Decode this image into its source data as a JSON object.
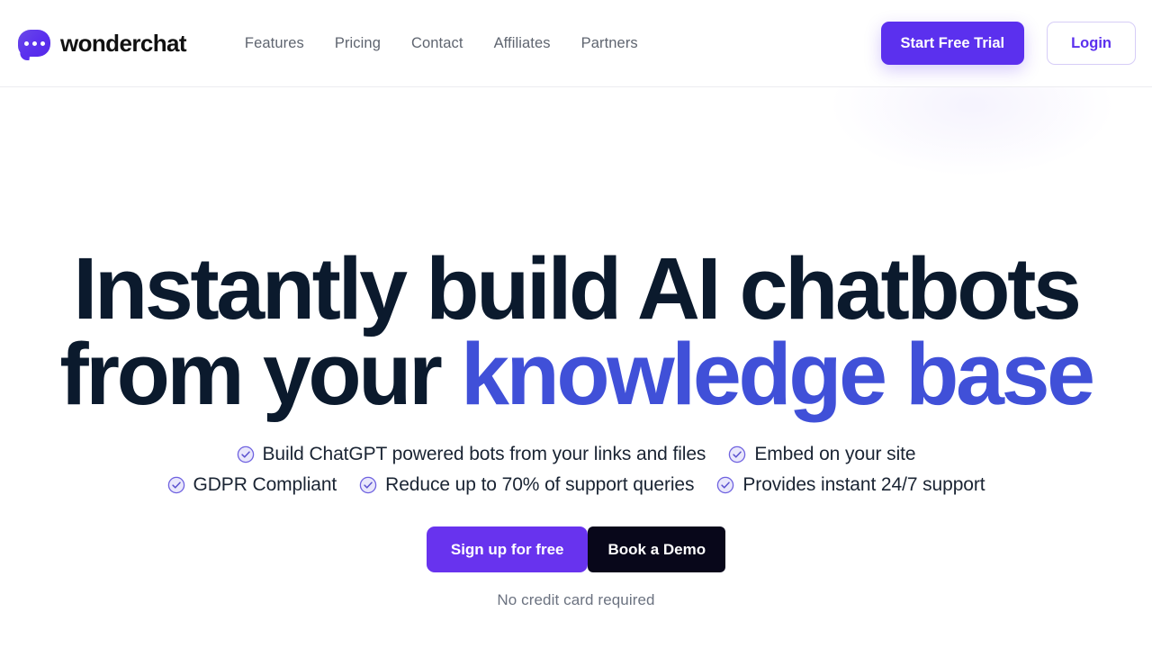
{
  "brand": {
    "name": "wonderchat",
    "logo_icon": "chat-bubble-icon",
    "logo_color": "#5b30ee"
  },
  "header": {
    "nav": [
      {
        "label": "Features"
      },
      {
        "label": "Pricing"
      },
      {
        "label": "Contact"
      },
      {
        "label": "Affiliates"
      },
      {
        "label": "Partners"
      }
    ],
    "trial_button": "Start Free Trial",
    "login_button": "Login",
    "trial_bg": "#5b30ee",
    "login_text_color": "#5b30ee"
  },
  "hero": {
    "headline_line1": "Instantly build AI chatbots",
    "headline_line2_plain": "from your ",
    "headline_line2_accent": "knowledge base",
    "headline_color": "#0b1a2d",
    "accent_color": "#4050d8",
    "bullets_row1": [
      {
        "icon": "check-circle-icon",
        "label": "Build ChatGPT powered bots from your links and files"
      },
      {
        "icon": "check-circle-icon",
        "label": "Embed on your site"
      }
    ],
    "bullets_row2": [
      {
        "icon": "check-circle-icon",
        "label": "GDPR Compliant"
      },
      {
        "icon": "check-circle-icon",
        "label": "Reduce up to 70% of support queries"
      },
      {
        "icon": "check-circle-icon",
        "label": "Provides instant 24/7 support"
      }
    ],
    "primary_cta": "Sign up for free",
    "secondary_cta": "Book a Demo",
    "primary_cta_bg": "#6833ee",
    "secondary_cta_bg": "#08071a",
    "fineprint": "No credit card required"
  }
}
